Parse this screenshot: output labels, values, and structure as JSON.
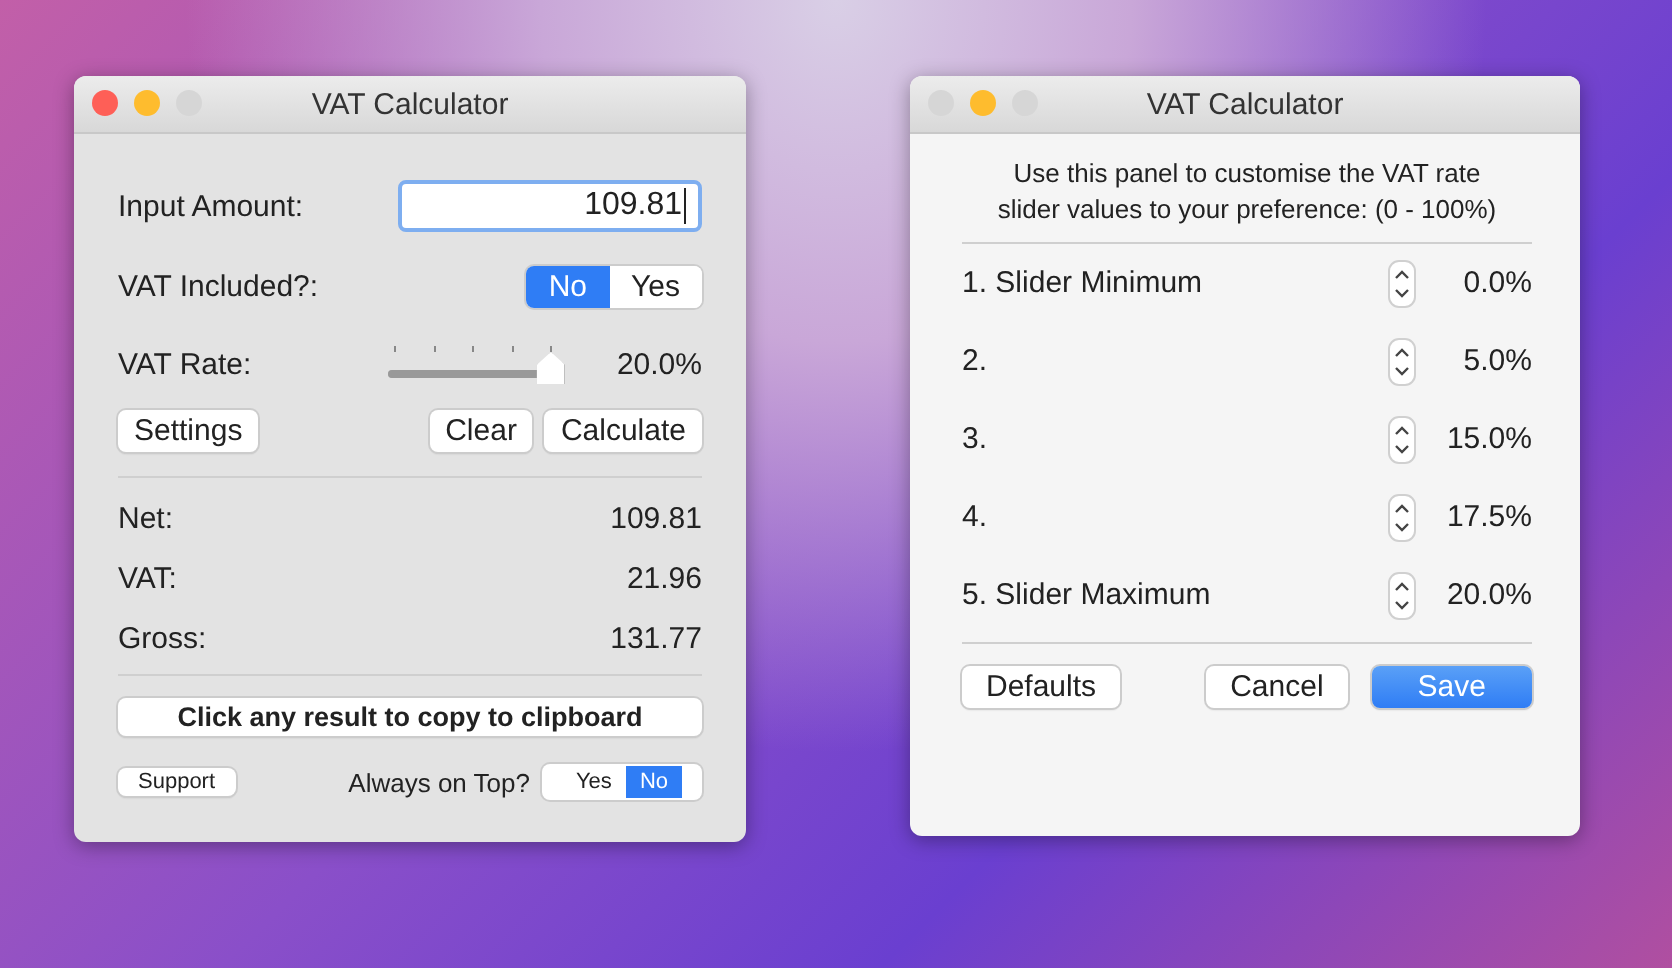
{
  "calculator_window": {
    "title": "VAT Calculator",
    "lights": [
      {
        "kind": "close",
        "active": true
      },
      {
        "kind": "minimize",
        "active": true
      },
      {
        "kind": "zoom",
        "active": false
      }
    ],
    "input_label": "Input Amount:",
    "input_value": "109.81",
    "vat_included": {
      "label": "VAT Included?:",
      "options": [
        {
          "label": "No",
          "selected": true
        },
        {
          "label": "Yes",
          "selected": false
        }
      ]
    },
    "vat_rate": {
      "label": "VAT Rate:",
      "level": 1,
      "reading": "20.0%"
    },
    "buttons": [
      "Settings",
      "Clear",
      "Calculate"
    ],
    "results": [
      {
        "label": "Net:",
        "value": "109.81"
      },
      {
        "label": "VAT:",
        "value": "21.96"
      },
      {
        "label": "Gross:",
        "value": "131.77"
      }
    ],
    "clipboard_button": "Click any result to copy to clipboard",
    "support_button": "Support",
    "always_on_top": {
      "label": "Always on Top?",
      "options": [
        {
          "label": "Yes",
          "selected": false
        },
        {
          "label": "No",
          "selected": true
        }
      ]
    }
  },
  "settings_window": {
    "title": "VAT Calculator",
    "lights": [
      {
        "kind": "close",
        "active": false
      },
      {
        "kind": "minimize",
        "active": true
      },
      {
        "kind": "zoom",
        "active": false
      }
    ],
    "intro": "Use this panel to customise the VAT rate slider values to your preference: (0 - 100%)",
    "rows": [
      {
        "label": "1. Slider Minimum",
        "value": "0.0%"
      },
      {
        "label": "2.",
        "value": "5.0%"
      },
      {
        "label": "3.",
        "value": "15.0%"
      },
      {
        "label": "4.",
        "value": "17.5%"
      },
      {
        "label": "5. Slider Maximum",
        "value": "20.0%"
      }
    ],
    "buttons": [
      {
        "label": "Defaults",
        "kind": "plain"
      },
      {
        "label": "Cancel",
        "kind": "plain"
      },
      {
        "label": "Save",
        "kind": "primary"
      }
    ]
  }
}
